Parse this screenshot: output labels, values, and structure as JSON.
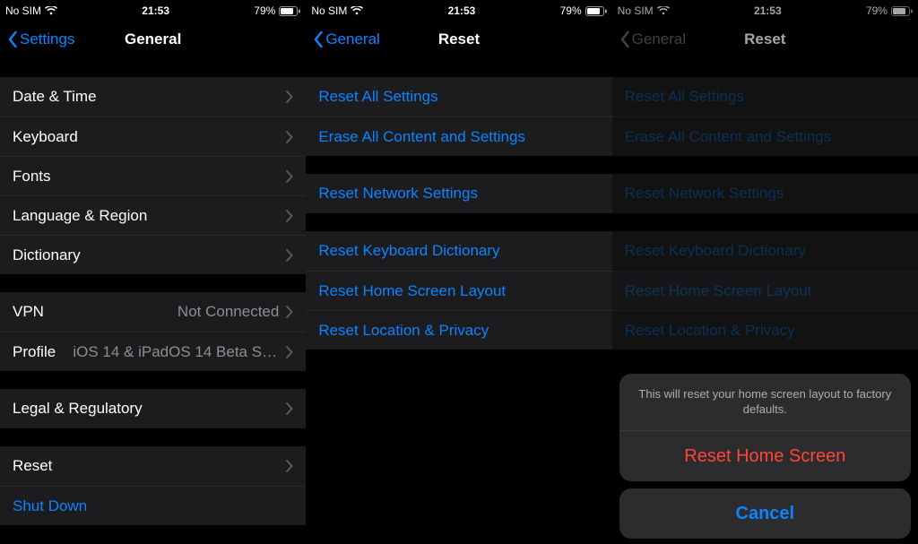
{
  "status": {
    "carrier": "No SIM",
    "time": "21:53",
    "battery": "79%"
  },
  "panel1": {
    "back": "Settings",
    "title": "General",
    "g1": {
      "date_time": "Date & Time",
      "keyboard": "Keyboard",
      "fonts": "Fonts",
      "lang_region": "Language & Region",
      "dictionary": "Dictionary"
    },
    "g2": {
      "vpn": "VPN",
      "vpn_detail": "Not Connected",
      "profile": "Profile",
      "profile_detail": "iOS 14 & iPadOS 14 Beta Softwar..."
    },
    "g3": {
      "legal": "Legal & Regulatory"
    },
    "g4": {
      "reset": "Reset",
      "shutdown": "Shut Down"
    }
  },
  "panel2": {
    "back": "General",
    "title": "Reset",
    "g1": {
      "reset_all": "Reset All Settings",
      "erase_all": "Erase All Content and Settings"
    },
    "g2": {
      "reset_network": "Reset Network Settings"
    },
    "g3": {
      "reset_kb": "Reset Keyboard Dictionary",
      "reset_home": "Reset Home Screen Layout",
      "reset_location": "Reset Location & Privacy"
    }
  },
  "panel3": {
    "back": "General",
    "title": "Reset",
    "g1": {
      "reset_all": "Reset All Settings",
      "erase_all": "Erase All Content and Settings"
    },
    "g2": {
      "reset_network": "Reset Network Settings"
    },
    "g3": {
      "reset_kb": "Reset Keyboard Dictionary",
      "reset_home": "Reset Home Screen Layout",
      "reset_location": "Reset Location & Privacy"
    },
    "sheet": {
      "message": "This will reset your home screen layout to factory defaults.",
      "destructive": "Reset Home Screen",
      "cancel": "Cancel"
    }
  }
}
